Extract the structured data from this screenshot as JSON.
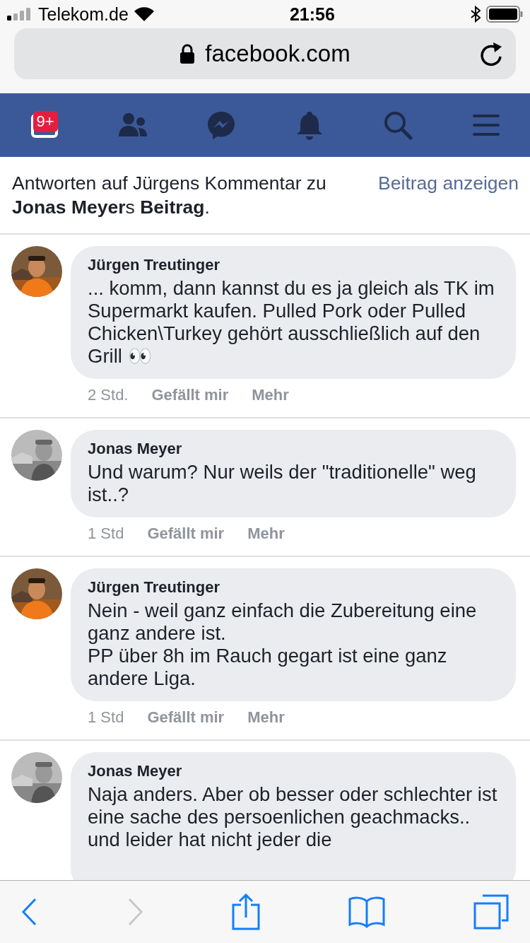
{
  "status_bar": {
    "carrier": "Telekom.de",
    "time": "21:56"
  },
  "address_bar": {
    "url": "facebook.com"
  },
  "nav_tabs": [
    {
      "kind": "feed",
      "selected": true,
      "badge": "9+"
    },
    {
      "kind": "friends",
      "selected": false
    },
    {
      "kind": "messenger",
      "selected": false
    },
    {
      "kind": "notifications",
      "selected": false
    },
    {
      "kind": "search",
      "selected": false
    },
    {
      "kind": "menu",
      "selected": false
    }
  ],
  "header": {
    "text": "Antworten auf Jürgens Kommentar zu **Jonas Meyer**s **Beitrag**.",
    "link": "Beitrag anzeigen"
  },
  "comments": [
    {
      "author": "Jürgen Treutinger",
      "text": "... komm, dann kannst du es ja gleich als TK im Supermarkt kaufen. Pulled Pork oder Pulled Chicken\\Turkey gehört ausschließlich auf den Grill 👀",
      "time": "2 Std.",
      "like": "Gefällt mir",
      "more": "Mehr"
    },
    {
      "author": "Jonas Meyer",
      "text": "Und warum? Nur weils der \"traditionelle\" weg ist..?",
      "time": "1 Std",
      "like": "Gefällt mir",
      "more": "Mehr"
    },
    {
      "author": "Jürgen Treutinger",
      "text": "Nein - weil ganz einfach die Zubereitung eine ganz andere ist.\nPP über 8h im Rauch gegart ist eine ganz andere Liga.",
      "time": "1 Std",
      "like": "Gefällt mir",
      "more": "Mehr"
    },
    {
      "author": "Jonas Meyer",
      "text": "Naja anders. Aber ob besser oder schlechter ist eine sache des persoenlichen geachmacks.. und leider hat nicht jeder die"
    }
  ],
  "toolbar": [
    {
      "kind": "back",
      "disabled": false
    },
    {
      "kind": "forward",
      "disabled": true
    },
    {
      "kind": "share",
      "disabled": false
    },
    {
      "kind": "bookmarks",
      "disabled": false
    },
    {
      "kind": "tabs",
      "disabled": false
    }
  ]
}
